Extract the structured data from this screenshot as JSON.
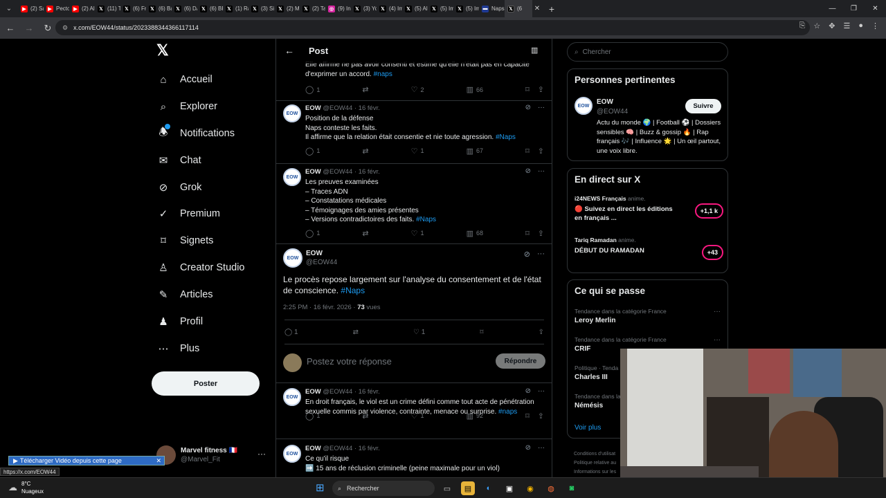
{
  "browser": {
    "tabs": [
      {
        "label": "(2) Sac",
        "icon": "youtube-icon",
        "color": "#ff0000"
      },
      {
        "label": "Pecto",
        "icon": "youtube-icon",
        "color": "#ff0000"
      },
      {
        "label": "(2) Ala",
        "icon": "youtube-icon",
        "color": "#ff0000"
      },
      {
        "label": "(11) Te",
        "icon": "x-icon",
        "color": "#000000"
      },
      {
        "label": "(6) Fro",
        "icon": "x-icon",
        "color": "#000000"
      },
      {
        "label": "(6) Ba",
        "icon": "x-icon",
        "color": "#000000"
      },
      {
        "label": "(6) DA",
        "icon": "x-icon",
        "color": "#000000"
      },
      {
        "label": "(6) BFI",
        "icon": "x-icon",
        "color": "#000000"
      },
      {
        "label": "(1) Rai",
        "icon": "x-icon",
        "color": "#000000"
      },
      {
        "label": "(3) Sifl",
        "icon": "x-icon",
        "color": "#000000"
      },
      {
        "label": "(2) Ma",
        "icon": "x-icon",
        "color": "#000000"
      },
      {
        "label": "(2) Taj",
        "icon": "x-icon",
        "color": "#000000"
      },
      {
        "label": "(9) Ins",
        "icon": "instagram-icon",
        "color": "#d6249f"
      },
      {
        "label": "(3) You",
        "icon": "x-icon",
        "color": "#000000"
      },
      {
        "label": "(4) Img",
        "icon": "x-icon",
        "color": "#000000"
      },
      {
        "label": "(5) Ale",
        "icon": "x-icon",
        "color": "#000000"
      },
      {
        "label": "(5) Img",
        "icon": "x-icon",
        "color": "#000000"
      },
      {
        "label": "(5) Img",
        "icon": "x-icon",
        "color": "#000000"
      },
      {
        "label": "Naps j",
        "icon": "flag-icon",
        "color": "#1f3a93"
      }
    ],
    "active_tab": "(6",
    "url": "x.com/EOW44/status/2023388344366117114",
    "status_url": "https://x.com/EOW44",
    "download_banner": "Télécharger Vidéo depuis cette page"
  },
  "nav": {
    "items": [
      {
        "label": "Accueil",
        "icon": "home-icon"
      },
      {
        "label": "Explorer",
        "icon": "search-icon"
      },
      {
        "label": "Notifications",
        "icon": "bell-icon"
      },
      {
        "label": "Chat",
        "icon": "mail-icon"
      },
      {
        "label": "Grok",
        "icon": "grok-icon"
      },
      {
        "label": "Premium",
        "icon": "premium-icon"
      },
      {
        "label": "Signets",
        "icon": "bookmark-icon"
      },
      {
        "label": "Creator Studio",
        "icon": "creator-icon"
      },
      {
        "label": "Articles",
        "icon": "articles-icon"
      },
      {
        "label": "Profil",
        "icon": "profile-icon"
      },
      {
        "label": "Plus",
        "icon": "more-icon"
      }
    ],
    "post_button": "Poster",
    "account": {
      "name": "Marvel fitness 🇫🇷",
      "handle": "@Marvel_Fit"
    }
  },
  "main": {
    "header_title": "Post",
    "top_text": "Elle affirme ne pas avoir consenti et estime qu'elle n'était pas en capacité d'exprimer un accord.",
    "top_hashtag": "#naps",
    "top_actions": {
      "replies": "1",
      "likes": "2",
      "views": "66"
    },
    "replies_above": [
      {
        "name": "EOW",
        "handle": "@EOW44 · 16 févr.",
        "lines": [
          "Position de la défense",
          "Naps conteste les faits.",
          "Il affirme que la relation était consentie et nie toute agression."
        ],
        "hashtag": "#Naps",
        "replies": "1",
        "likes": "1",
        "views": "67"
      },
      {
        "name": "EOW",
        "handle": "@EOW44 · 16 févr.",
        "lines": [
          "Les preuves examinées",
          "– Traces ADN",
          "– Constatations médicales",
          "– Témoignages des amies présentes",
          "– Versions contradictoires des faits."
        ],
        "hashtag": "#Naps",
        "replies": "1",
        "likes": "1",
        "views": "68"
      }
    ],
    "focus": {
      "name": "EOW",
      "handle": "@EOW44",
      "text": "Le procès repose largement sur l'analyse du consentement et de l'état de conscience.",
      "hashtag": "#Naps",
      "timestamp": "2:25 PM · 16 févr. 2026 · ",
      "views": "73",
      "views_label": " vues",
      "replies": "1",
      "likes": "1"
    },
    "reply_placeholder": "Postez votre réponse",
    "reply_button": "Répondre",
    "replies_below": [
      {
        "name": "EOW",
        "handle": "@EOW44 · 16 févr.",
        "lines": [
          "En droit français, le viol est un crime défini comme tout acte de pénétration sexuelle commis par violence, contrainte, menace ou surprise."
        ],
        "hashtag": "#naps",
        "replies": "1",
        "likes": "1",
        "views": "92"
      },
      {
        "name": "EOW",
        "handle": "@EOW44 · 16 févr.",
        "lines": [
          "Ce qu'il risque",
          "➡️ 15 ans de réclusion criminelle (peine maximale pour un viol)"
        ],
        "hashtag": ""
      }
    ]
  },
  "right": {
    "search_placeholder": "Chercher",
    "relevant_title": "Personnes pertinentes",
    "relevant": {
      "name": "EOW",
      "handle": "@EOW44",
      "follow": "Suivre",
      "bio": "Actu du monde 🌍 | Football ⚽ | Dossiers sensibles 🧠 | Buzz & gossip 🔥 | Rap français 🎶 | Influence 🌟 | Un œil partout, une voix libre."
    },
    "live_title": "En direct sur X",
    "live": [
      {
        "source": "i24NEWS Français",
        "suffix": "anime.",
        "title": "🔴 Suivez en direct les éditions en français ...",
        "count": "+1,1 k"
      },
      {
        "source": "Tariq Ramadan",
        "suffix": "anime.",
        "title": "DÉBUT DU RAMADAN",
        "count": "+43"
      }
    ],
    "trends_title": "Ce qui se passe",
    "trends": [
      {
        "context": "Tendance dans la catégorie France",
        "title": "Leroy Merlin"
      },
      {
        "context": "Tendance dans la catégorie France",
        "title": "CRIF"
      },
      {
        "context": "Politique · Tenda",
        "title": "Charles III"
      },
      {
        "context": "Tendance dans la",
        "title": "Némésis"
      }
    ],
    "see_more": "Voir plus",
    "footer": [
      "Conditions d'utilisat",
      "Politique relative au",
      "Informations sur les"
    ]
  },
  "taskbar": {
    "temp": "8°C",
    "weather": "Nuageux",
    "search": "Rechercher"
  },
  "colors": {
    "accent": "#1d9bf0",
    "live_ring": "#f91880",
    "background": "#000000"
  }
}
